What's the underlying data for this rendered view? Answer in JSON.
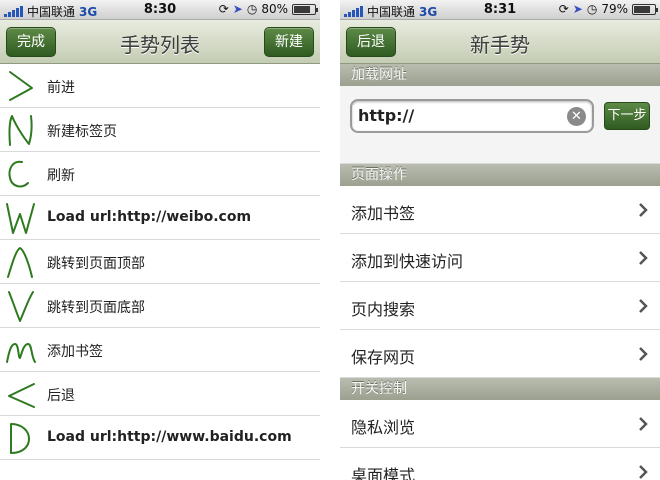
{
  "left": {
    "status": {
      "carrier": "中国联通",
      "network": "3G",
      "time": "8:30",
      "battery_pct_text": "80%",
      "battery_fraction": 0.8
    },
    "nav": {
      "left_button": "完成",
      "title": "手势列表",
      "right_button": "新建"
    },
    "gestures": [
      {
        "icon": "gesture-gt-icon",
        "label": "前进",
        "is_url": false
      },
      {
        "icon": "gesture-n-icon",
        "label": "新建标签页",
        "is_url": false
      },
      {
        "icon": "gesture-circle-icon",
        "label": "刷新",
        "is_url": false
      },
      {
        "icon": "gesture-w-icon",
        "label": "Load url:http://weibo.com",
        "is_url": true
      },
      {
        "icon": "gesture-caret-up-icon",
        "label": "跳转到页面顶部",
        "is_url": false
      },
      {
        "icon": "gesture-v-icon",
        "label": "跳转到页面底部",
        "is_url": false
      },
      {
        "icon": "gesture-m-icon",
        "label": "添加书签",
        "is_url": false
      },
      {
        "icon": "gesture-lt-icon",
        "label": "后退",
        "is_url": false
      },
      {
        "icon": "gesture-d-icon",
        "label": "Load url:http://www.baidu.com",
        "is_url": true
      }
    ]
  },
  "right": {
    "status": {
      "carrier": "中国联通",
      "network": "3G",
      "time": "8:31",
      "battery_pct_text": "79%",
      "battery_fraction": 0.79
    },
    "nav": {
      "left_button": "后退",
      "title": "新手势"
    },
    "sections": {
      "load_url": "加载网址",
      "page_ops": "页面操作",
      "switches": "开关控制"
    },
    "url_input": {
      "value": "http://"
    },
    "next_button": "下一步",
    "page_ops": [
      "添加书签",
      "添加到快速访问",
      "页内搜索",
      "保存网页"
    ],
    "switches": [
      "隐私浏览",
      "桌面模式"
    ]
  }
}
